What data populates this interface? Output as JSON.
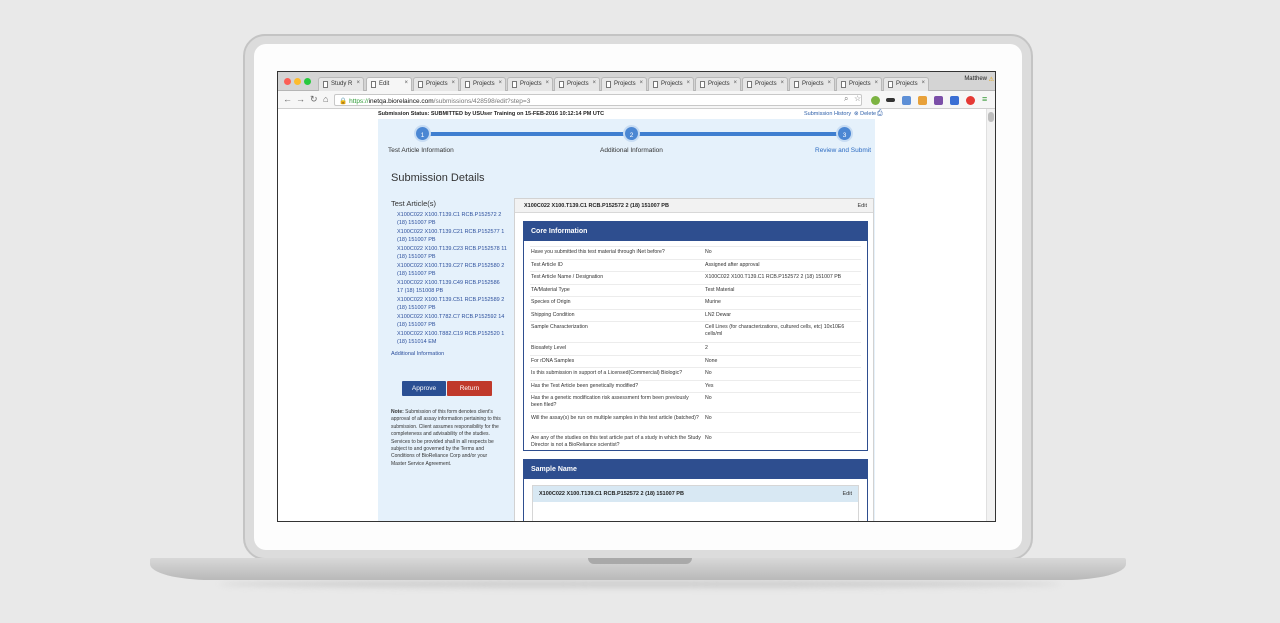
{
  "browser": {
    "tabs": [
      {
        "label": "Study R",
        "active": false
      },
      {
        "label": "Edit",
        "active": true
      },
      {
        "label": "Projects",
        "active": false
      },
      {
        "label": "Projects",
        "active": false
      },
      {
        "label": "Projects",
        "active": false
      },
      {
        "label": "Projects",
        "active": false
      },
      {
        "label": "Projects",
        "active": false
      },
      {
        "label": "Projects",
        "active": false
      },
      {
        "label": "Projects",
        "active": false
      },
      {
        "label": "Projects",
        "active": false
      },
      {
        "label": "Projects",
        "active": false
      },
      {
        "label": "Projects",
        "active": false
      },
      {
        "label": "Projects",
        "active": false
      }
    ],
    "user": "Matthew",
    "url": {
      "scheme": "https://",
      "host": "inetqa.biorelaince.com",
      "path": "/submissions/428598/edit?step=3"
    }
  },
  "header": {
    "status": "Submission Status: SUBMITTED by USUser Training on 15-FEB-2016 10:12:14 PM UTC",
    "history": "Submission History",
    "delete": "Delete"
  },
  "steps": [
    {
      "num": "1",
      "label": "Test Article Information"
    },
    {
      "num": "2",
      "label": "Additional Information"
    },
    {
      "num": "3",
      "label": "Review and Submit"
    }
  ],
  "sidebar": {
    "title": "Submission Details",
    "test_articles_title": "Test Article(s)",
    "articles": [
      "X100C022 X100.T139.C1 RCB.P152572 2 (18) 151007 PB",
      "X100C022 X100.T139.C21 RCB.P152577 1 (18) 151007 PB",
      "X100C022 X100.T139.C23 RCB.P152578 11 (18) 151007 PB",
      "X100C022 X100.T139.C27 RCB.P152580 2 (18) 151007 PB",
      "X100C022 X100.T139.C49 RCB.P152586 17 (18) 151008 PB",
      "X100C022 X100.T139.C51 RCB.P152589 2 (18) 151007 PB",
      "X100C022 X100.T782.C7 RCB.P152592 14 (18) 151007 PB",
      "X100C022 X100.T882.C19 RCB.P152520 1 (18) 151014 EM"
    ],
    "additional_link": "Additional Information",
    "approve": "Approve",
    "return": "Return",
    "note_label": "Note:",
    "note_text": "Submission of this form denotes client's approval of all assay information pertaining to this submission. Client assumes responsibility for the completeness and advisability of the studies. Services to be provided shall in all respects be subject to and governed by the Terms and Conditions of BioReliance Corp and/or your Master Service Agreement."
  },
  "main": {
    "article_header": "X100C022 X100.T139.C1 RCB.P152572 2 (18) 151007 PB",
    "edit": "Edit",
    "core_title": "Core Information",
    "core_rows": [
      {
        "q": "Have you submitted this test material through iNet before?",
        "a": "No"
      },
      {
        "q": "Test Article ID",
        "a": "Assigned after approval"
      },
      {
        "q": "Test Article Name / Designation",
        "a": "X100C022 X100.T139.C1 RCB.P152572 2 (18) 151007 PB"
      },
      {
        "q": "TA/Material Type",
        "a": "Test Material"
      },
      {
        "q": "Species of Origin",
        "a": "Murine"
      },
      {
        "q": "Shipping Condition",
        "a": "LN2 Dewar"
      },
      {
        "q": "Sample Characterization",
        "a": "Cell Lines (for characterizations, cultured cells, etc) 10x10E6 cells/ml"
      },
      {
        "q": "Biosafety Level",
        "a": "2"
      },
      {
        "q": "For rDNA Samples",
        "a": "None"
      },
      {
        "q": "Is this submission in support of a Licensed(Commercial) Biologic?",
        "a": "No"
      },
      {
        "q": "Has the Test Article been genetically modified?",
        "a": "Yes"
      },
      {
        "q": "Has the a genetic modification risk assessment form been previously been filed?",
        "a": "No"
      },
      {
        "q": "Will the assay(s) be run on multiple samples in this test article (batched)?",
        "a": "No"
      },
      {
        "q": "Are any of the studies on this test article part of a study in which the Study Director is not a BioReliance scientist?",
        "a": "No"
      }
    ],
    "sample_title": "Sample Name",
    "sample_sub": "X100C022 X100.T139.C1 RCB.P152572 2 (18) 151007 PB",
    "sample_edit": "Edit"
  }
}
